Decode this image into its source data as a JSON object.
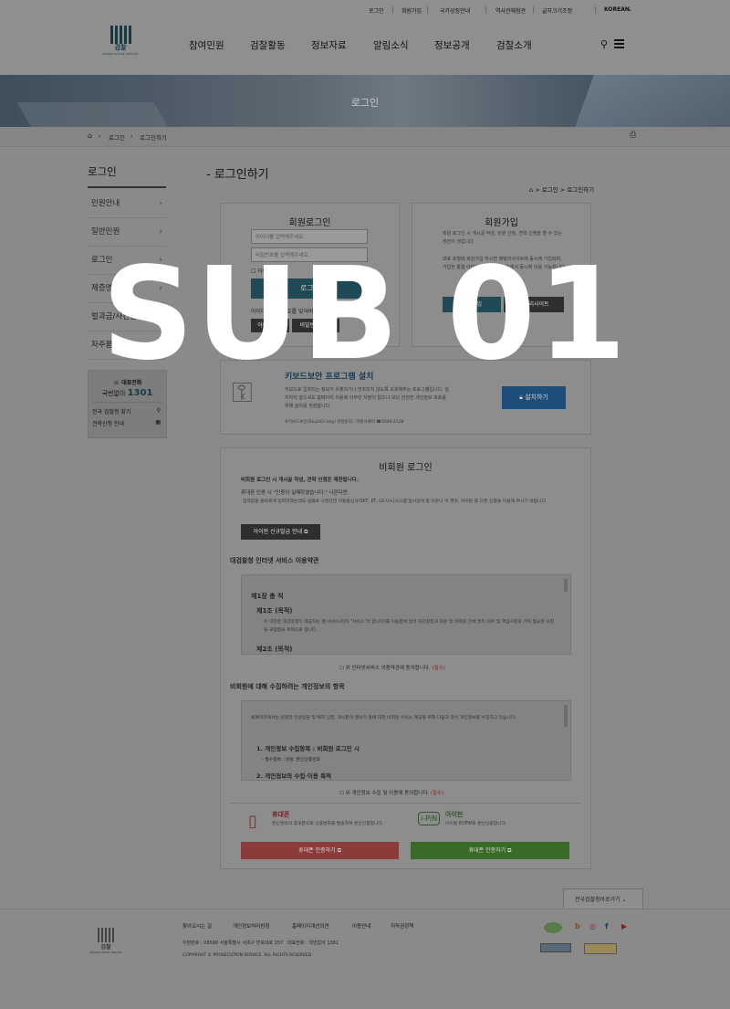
{
  "util": {
    "login": "로그인",
    "join": "회원가입",
    "portal": "국가상징안내",
    "history": "역사관체험관",
    "fontsize": "글자크기조정",
    "lang": "KOREAN"
  },
  "logo": {
    "name": "검찰",
    "en": "PROSECUTION SERVICE"
  },
  "menu": [
    "참여민원",
    "검찰활동",
    "정보자료",
    "알림소식",
    "정보공개",
    "검찰소개"
  ],
  "banner_title": "로그인",
  "breadcrumb": {
    "a": "로그인",
    "b": "로그인하기"
  },
  "lnb": {
    "title": "로그인",
    "items": [
      "민원안내",
      "일반민원",
      "로그인",
      "제증명민원",
      "벌과금/사건검색",
      "자주묻는질문"
    ]
  },
  "callbox": {
    "label": "대표전화",
    "sub": "국번없이",
    "num": "1301",
    "l1": "전국 검찰청 찾기",
    "l2": "견학신청 안내"
  },
  "content": {
    "title": "- 로그인하기",
    "path": "> 로그인 > 로그인하기"
  },
  "member": {
    "title": "회원로그인",
    "id_ph": "아이디를 입력해주세요.",
    "pw_ph": "비밀번호를 입력해주세요.",
    "save": "아이디저장",
    "login": "로그인",
    "q": "아이디 / 비밀번호를 잊어버리셨나요?",
    "find_id": "아이디찾기",
    "find_pw": "비밀번호 찾기"
  },
  "join": {
    "title": "회원가입",
    "p1": "회원 로그인 시 게시글 작성, 민원 신청, 견학 신청을 할 수 있는 권한이 생깁니다.",
    "p2": "대표 포털에 회원가입 하시면 패밀리사이트에 동시에 가입되며, 가입한 통합 아이디로 패밀리사이트에서 동시에 이용 가능합니다.",
    "btn1": "회원가입",
    "btn2": "패밀리사이트"
  },
  "keyboard": {
    "title": "키보드보안 프로그램 설치",
    "p": "키보드로 입력되는 정보가 유출되거나 변조되지 않도록 보호해주는 프로그램입니다. 설치하지 않으셔도 홈페이지 이용에 아무런 지장이 없으나 보다 안전한 개인정보 보호를 위해 설치를 권장합니다.",
    "note": "※키보드보안(TouchEn key) 관련문의 : 라온시큐어 ☎1644-4128",
    "btn": "설치하기"
  },
  "guest": {
    "title": "비회원 로그인",
    "l1": "비회원 로그인 시 게시글 작성, 견학 신청은 제한됩니다.",
    "l2": "휴대폰 인증 시 \"인증이 실패하였습니다.\" 나온다면",
    "l3": "입력값을 올바르게 입력하였는데도 실패로 나온다면 이동통신사(SKT, KT, LG U+)시스템 일시장애 등 이유나 이 경우, 아이핀 등 다른 인증을 이용해 주시기 바랍니다.",
    "ipin_btn": "아이핀 신규발급 안내",
    "terms_title": "대검찰청 인터넷 서비스 이용약관",
    "ch": "제1장 총 칙",
    "a1": "제1조 (목적)",
    "a1p": "이 약관은 대검찰청이 제공하는 웹 서비스(이하 \"서비스\"라 합니다)를 이용함에 있어 대검찰청과 회원 및 비회원 간에 권리·의무 및 책임사항과 기타 필요한 사항을 규정함을 목적으로 합니다.",
    "a2": "제2조 (목적)",
    "agree1": "위 인터넷서비스 이용약관에 동의합니다.",
    "req": "(필수)",
    "priv_title": "비회원에 대해 수집하려는 개인정보의 항목",
    "priv_p": "홈페이지에서는 원활한 민원상담 및 예약 신청, 게시판의 글쓰기 등에 대한 비회원 서비스 제공을 위해 다음과 같이 개인정보를 수집하고 있습니다.",
    "p1": "1. 개인정보 수집항목 : 비회원 로그인 시",
    "p1s": "- 필수항목 : 성명, 본인인증번호",
    "p2": "2. 개인정보의 수집·이용 목적",
    "agree2": "위 개인정보 수집 및 이용에 동의합니다.",
    "phone_t": "휴대폰",
    "phone_p": "본인명의의 휴대폰으로 인증번호를 발송하여 본인인증합니다.",
    "ipin_t": "아이핀",
    "ipin_p": "아이핀 ID/PW로 본인인증합니다.",
    "phone_btn": "휴대폰 인증하기",
    "ipin_btn2": "휴대폰 인증하기"
  },
  "goto": "전국검찰청바로가기",
  "footer": {
    "links": [
      "찾아오시는 길",
      "개인정보처리방침",
      "홈페이지개선의견",
      "이용안내",
      "저작권정책"
    ],
    "addr": "우편번호 : 06590 서울특별시 서초구 반포대로 157",
    "tel": "대표전화 : 국번없이 1301",
    "copy": "COPYRIGHT © PROSECUTION SERVICE. ALL RIGHTS RESERVED."
  },
  "overlay": "SUB 01",
  "colors": {
    "teal": "#1f4a55",
    "red": "#b23a3a",
    "green": "#3a7d2a"
  }
}
